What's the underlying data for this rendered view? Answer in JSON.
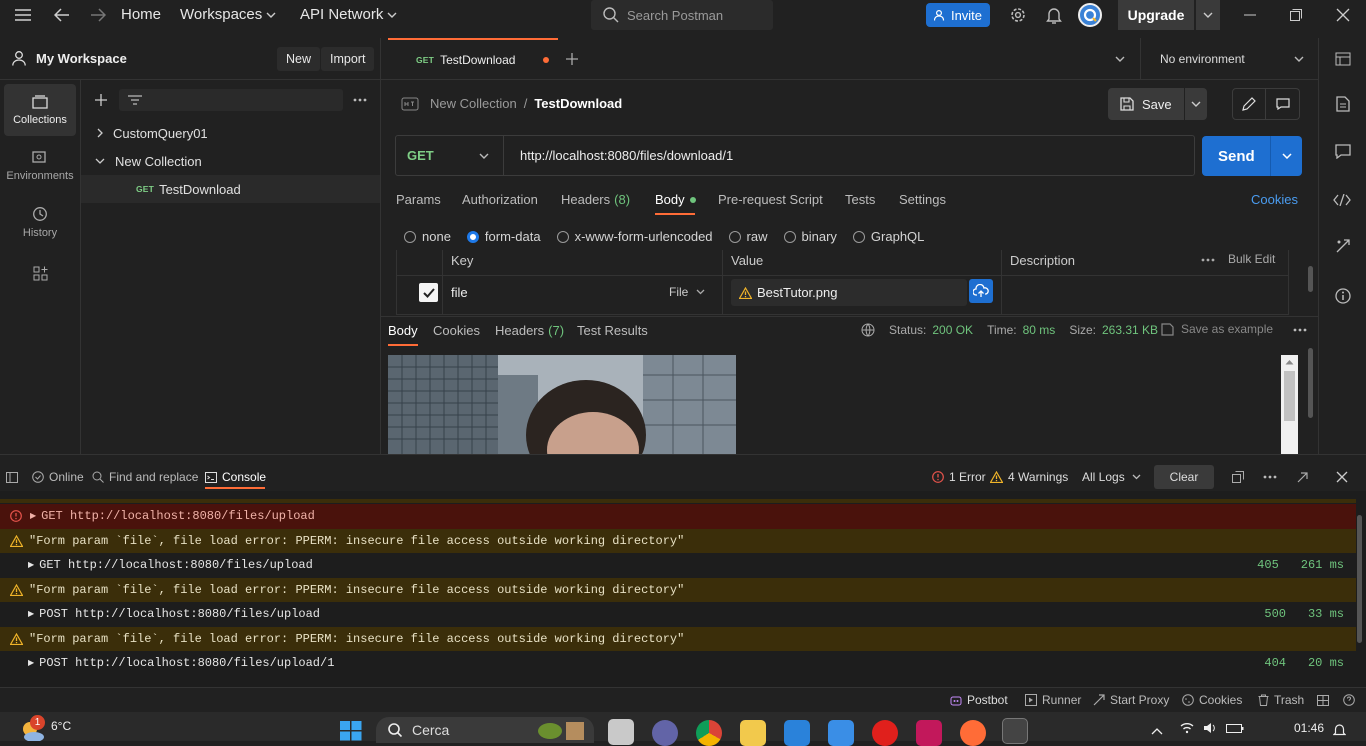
{
  "topbar": {
    "home": "Home",
    "workspaces": "Workspaces",
    "api_network": "API Network",
    "search_placeholder": "Search Postman",
    "invite": "Invite",
    "upgrade": "Upgrade"
  },
  "sidebar": {
    "workspace": "My Workspace",
    "new_btn": "New",
    "import_btn": "Import",
    "rail": [
      {
        "label": "Collections",
        "icon": "collections-icon"
      },
      {
        "label": "Environments",
        "icon": "environments-icon"
      },
      {
        "label": "History",
        "icon": "history-icon"
      }
    ],
    "tree": [
      {
        "label": "CustomQuery01"
      },
      {
        "label": "New Collection"
      },
      {
        "method": "GET",
        "label": "TestDownload"
      }
    ]
  },
  "tabs": {
    "active": {
      "method": "GET",
      "name": "TestDownload"
    },
    "environment": "No environment"
  },
  "request": {
    "breadcrumb_parent": "New Collection",
    "breadcrumb_sep": "/",
    "breadcrumb_current": "TestDownload",
    "save": "Save",
    "method": "GET",
    "url": "http://localhost:8080/files/download/1",
    "send": "Send",
    "subtabs": [
      "Params",
      "Authorization",
      "Headers",
      "Body",
      "Pre-request Script",
      "Tests",
      "Settings"
    ],
    "headers_count": "(8)",
    "cookies": "Cookies",
    "body_modes": [
      "none",
      "form-data",
      "x-www-form-urlencoded",
      "raw",
      "binary",
      "GraphQL"
    ],
    "table_headers": {
      "key": "Key",
      "value": "Value",
      "description": "Description",
      "bulk_edit": "Bulk Edit"
    },
    "row": {
      "key": "file",
      "type": "File",
      "value": "BestTutor.png"
    }
  },
  "response": {
    "tabs": [
      "Body",
      "Cookies",
      "Headers",
      "Test Results"
    ],
    "headers_count": "(7)",
    "status_label": "Status:",
    "status": "200 OK",
    "time_label": "Time:",
    "time": "80 ms",
    "size_label": "Size:",
    "size": "263.31 KB",
    "save_example": "Save as example"
  },
  "console": {
    "online": "Online",
    "find_replace": "Find and replace",
    "console": "Console",
    "errors": "1 Error",
    "warnings": "4 Warnings",
    "all_logs": "All Logs",
    "clear": "Clear",
    "lines": [
      {
        "kind": "err",
        "text": "GET http://localhost:8080/files/upload",
        "code": "",
        "time": ""
      },
      {
        "kind": "warn",
        "text": "\"Form param `file`, file load error: PPERM: insecure file access outside working directory\"",
        "code": "",
        "time": ""
      },
      {
        "kind": "norm",
        "text": "GET http://localhost:8080/files/upload",
        "code": "405",
        "time": "261 ms"
      },
      {
        "kind": "warn",
        "text": "\"Form param `file`, file load error: PPERM: insecure file access outside working directory\"",
        "code": "",
        "time": ""
      },
      {
        "kind": "norm",
        "text": "POST http://localhost:8080/files/upload",
        "code": "500",
        "time": "33 ms"
      },
      {
        "kind": "warn",
        "text": "\"Form param `file`, file load error: PPERM: insecure file access outside working directory\"",
        "code": "",
        "time": ""
      },
      {
        "kind": "norm",
        "text": "POST http://localhost:8080/files/upload/1",
        "code": "404",
        "time": "20 ms"
      }
    ]
  },
  "statusbar": {
    "postbot": "Postbot",
    "runner": "Runner",
    "start_proxy": "Start Proxy",
    "cookies": "Cookies",
    "trash": "Trash"
  },
  "taskbar": {
    "weather_badge": "1",
    "temperature": "6°C",
    "search": "Cerca",
    "time": "01:46"
  },
  "colors": {
    "accent": "#ff6c37",
    "primary": "#1e6fd1",
    "status_ok": "#6fc47d",
    "warning": "#f0b429",
    "error": "#e5534b"
  }
}
